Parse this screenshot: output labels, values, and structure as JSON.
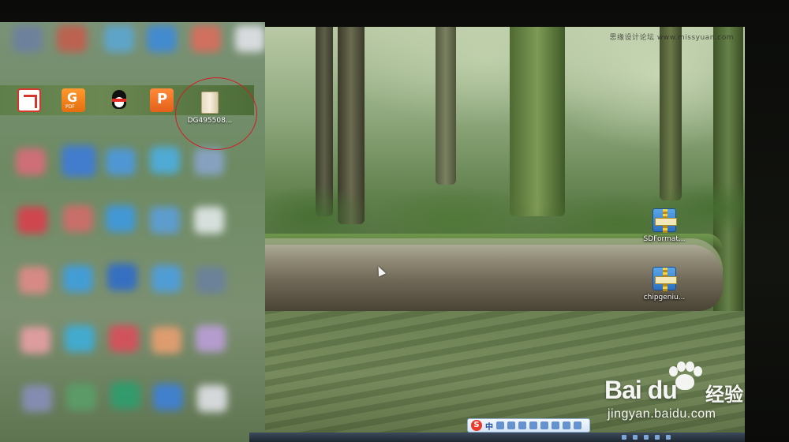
{
  "desktop": {
    "site_watermark": "思缘设计论坛 www.missyuan.com",
    "icons": [
      {
        "label": "SDFormat...",
        "icon": "winrar-archive-icon"
      },
      {
        "label": "chipgeniu...",
        "icon": "winrar-archive-icon"
      }
    ]
  },
  "start_screen": {
    "pinned_apps": [
      {
        "icon": "office-app-icon"
      },
      {
        "icon": "pdf-reader-icon",
        "text": "PDF"
      },
      {
        "icon": "qq-penguin-icon"
      },
      {
        "icon": "wps-app-icon"
      }
    ],
    "highlighted_file": {
      "label": "DG495508...",
      "icon": "folder-icon"
    }
  },
  "ime_toolbar": {
    "logo": "S",
    "mode": "中"
  },
  "watermark": {
    "brand": "Bai du",
    "product": "经验",
    "url": "jingyan.baidu.com"
  },
  "colors": {
    "highlight_ring": "#d21d25",
    "pdf_orange": "#e46d10",
    "qq_scarf": "#e52b26",
    "archive_blue": "#2e6fbf"
  }
}
